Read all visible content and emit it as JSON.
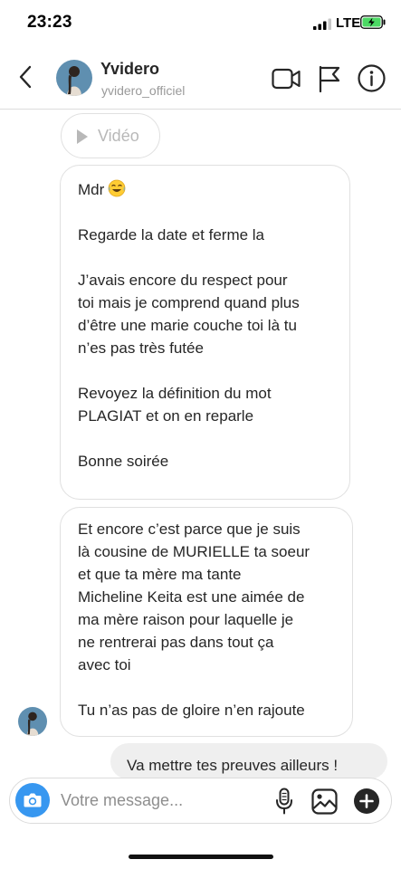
{
  "status_bar": {
    "time": "23:23",
    "network": "LTE",
    "signal_bars": 3,
    "battery_charging": true
  },
  "header": {
    "back_icon": "chevron-left-icon",
    "name": "Yvidero",
    "username": "yvidero_officiel",
    "actions": [
      "video-call-icon",
      "flag-icon",
      "info-icon"
    ]
  },
  "messages": {
    "video_attachment_label": "Vidéo",
    "received_1": [
      "Mdr",
      "Regarde la date et ferme la",
      "J’avais encore du respect pour\ntoi mais je comprend quand plus\nd’être une marie couche toi là tu\nn’es pas très futée",
      "Revoyez la définition du mot\nPLAGIAT et on en reparle",
      "Bonne soirée"
    ],
    "received_1_emoji": "face-with-tears-of-joy",
    "received_2": [
      "Et encore c’est parce que je suis\nlà cousine de MURIELLE ta soeur\net que ta mère ma tante\nMicheline Keita est une aimée de\nma mère raison pour laquelle je\nne rentrerai pas dans tout ça\navec toi",
      "Tu n’as pas de gloire n’en rajoute"
    ],
    "sent_partial": "Va mettre tes preuves ailleurs !"
  },
  "composer": {
    "placeholder": "Votre message...",
    "icons": [
      "camera-icon",
      "microphone-icon",
      "gallery-icon",
      "plus-icon"
    ]
  },
  "colors": {
    "accent": "#3797f0",
    "bubble_border": "#e0e0e0",
    "sent_bubble": "#efefef",
    "battery": "#4cd964"
  }
}
